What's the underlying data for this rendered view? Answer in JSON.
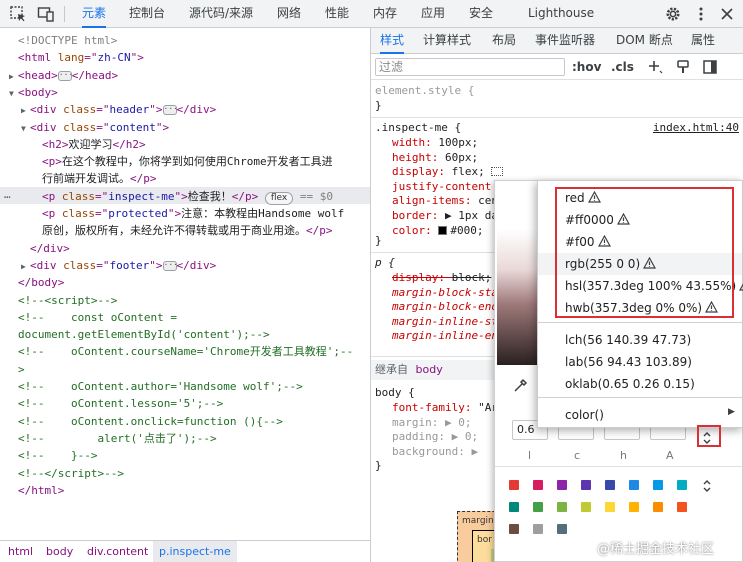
{
  "toolbar": {
    "tabs": [
      "元素",
      "控制台",
      "源代码/来源",
      "网络",
      "性能",
      "内存",
      "应用",
      "安全",
      "Lighthouse"
    ],
    "active_tab": "元素"
  },
  "elements": {
    "lines": [
      {
        "indent": 0,
        "html": "<span class='dt'>&lt;!DOCTYPE html&gt;</span>"
      },
      {
        "indent": 0,
        "html": "<span class='tag'>&lt;html </span><span class='an'>lang</span><span class='tag'>=\"</span><span class='av'>zh-CN</span><span class='tag'>\"&gt;</span>"
      },
      {
        "indent": 0,
        "tri": "▶",
        "html": "<span class='tag'>&lt;head&gt;</span><span class='dots'>···</span><span class='tag'>&lt;/head&gt;</span>"
      },
      {
        "indent": 0,
        "tri": "▼",
        "html": "<span class='tag'>&lt;body&gt;</span>"
      },
      {
        "indent": 1,
        "tri": "▶",
        "html": "<span class='tag'>&lt;div </span><span class='an'>class</span><span class='tag'>=\"</span><span class='av'>header</span><span class='tag'>\"&gt;</span><span class='dots'>···</span><span class='tag'>&lt;/div&gt;</span>"
      },
      {
        "indent": 1,
        "tri": "▼",
        "html": "<span class='tag'>&lt;div </span><span class='an'>class</span><span class='tag'>=\"</span><span class='av'>content</span><span class='tag'>\"&gt;</span>"
      },
      {
        "indent": 2,
        "html": "<span class='tag'>&lt;h2&gt;</span><span class='txt'>欢迎学习</span><span class='tag'>&lt;/h2&gt;</span>"
      },
      {
        "indent": 2,
        "html": "<span class='tag'>&lt;p&gt;</span><span class='txt'>在这个教程中，你将学到如何使用Chrome开发者工具进</span>"
      },
      {
        "indent": 2,
        "html": "<span class='txt'>行前端开发调试。</span><span class='tag'>&lt;/p&gt;</span>"
      },
      {
        "indent": 2,
        "sel": true,
        "html": "<span class='tag'>&lt;p </span><span class='an'>class</span><span class='tag'>=\"</span><span class='av'>inspect-me</span><span class='tag'>\"&gt;</span><span class='txt'>检查我！</span><span class='tag'>&lt;/p&gt;</span> <span class='badge'>flex</span> <span class='dt'>== $0</span>"
      },
      {
        "indent": 2,
        "html": "<span class='tag'>&lt;p </span><span class='an'>class</span><span class='tag'>=\"</span><span class='av'>protected</span><span class='tag'>\"&gt;</span><span class='txt'>注意：本教程由Handsome wolf</span>"
      },
      {
        "indent": 2,
        "html": "<span class='txt'>原创，版权所有，未经允许不得转载或用于商业用途。</span><span class='tag'>&lt;/p&gt;</span>"
      },
      {
        "indent": 1,
        "html": "<span class='tag'>&lt;/div&gt;</span>"
      },
      {
        "indent": 1,
        "tri": "▶",
        "html": "<span class='tag'>&lt;div </span><span class='an'>class</span><span class='tag'>=\"</span><span class='av'>footer</span><span class='tag'>\"&gt;</span><span class='dots'>···</span><span class='tag'>&lt;/div&gt;</span>"
      },
      {
        "indent": 0,
        "html": "<span class='tag'>&lt;/body&gt;</span>"
      },
      {
        "indent": 0,
        "html": "<span class='cm'>&lt;!--&lt;script&gt;--&gt;</span>"
      },
      {
        "indent": 0,
        "html": "<span class='cm'>&lt;!--    const oContent =</span>"
      },
      {
        "indent": 0,
        "html": "<span class='cm'>document.getElementById('content');--&gt;</span>"
      },
      {
        "indent": 0,
        "html": "<span class='cm'>&lt;!--    oContent.courseName='Chrome开发者工具教程';--</span>"
      },
      {
        "indent": 0,
        "html": "<span class='cm'>&gt;</span>"
      },
      {
        "indent": 0,
        "html": "<span class='cm'>&lt;!--    oContent.author='Handsome wolf';--&gt;</span>"
      },
      {
        "indent": 0,
        "html": "<span class='cm'>&lt;!--    oContent.lesson='5';--&gt;</span>"
      },
      {
        "indent": 0,
        "html": "<span class='cm'>&lt;!--    oContent.onclick=function (){--&gt;</span>"
      },
      {
        "indent": 0,
        "html": "<span class='cm'>&lt;!--        alert('点击了');--&gt;</span>"
      },
      {
        "indent": 0,
        "html": "<span class='cm'>&lt;!--    }--&gt;</span>"
      },
      {
        "indent": 0,
        "html": "<span class='cm'>&lt;!--&lt;/script&gt;--&gt;</span>"
      },
      {
        "indent": 0,
        "html": "<span class='tag'>&lt;/html&gt;</span>"
      }
    ]
  },
  "breadcrumbs": [
    "html",
    "body",
    "div.content",
    "p.inspect-me"
  ],
  "styles": {
    "subtabs": [
      "样式",
      "计算样式",
      "布局",
      "事件监听器",
      "DOM 断点",
      "属性"
    ],
    "filter_placeholder": "过滤",
    "hov": ":hov",
    "cls": ".cls",
    "element_style": "element.style {",
    "close_brace": "}",
    "rule_selector": ".inspect-me {",
    "rule_source": "index.html:40",
    "rule_lines": [
      {
        "p": "width",
        "v": "100px;"
      },
      {
        "p": "height",
        "v": "60px;"
      },
      {
        "p": "display",
        "v": "flex;"
      },
      {
        "p": "justify-content",
        "v": "cente"
      },
      {
        "p": "align-items",
        "v": "center;"
      },
      {
        "p": "border",
        "v": "▶ 1px dashed"
      },
      {
        "p": "color",
        "v": "#000;"
      }
    ],
    "p_selector": "p {",
    "p_lines": [
      {
        "p": "display",
        "v": "block;",
        "strike": true
      },
      {
        "p": "margin-block-sta",
        "v": "",
        "italic": true
      },
      {
        "p": "margin-block-end",
        "v": "",
        "italic": true
      },
      {
        "p": "margin-inline-st",
        "v": "",
        "italic": true
      },
      {
        "p": "margin-inline-en",
        "v": "",
        "italic": true
      }
    ],
    "inherited_label": "继承自",
    "inherited_from": "body",
    "body_selector": "body {",
    "body_lines": [
      {
        "p": "font-family",
        "v": "\"Ar",
        "dim": false
      },
      {
        "p": "margin",
        "v": "▶ 0;",
        "dim": true
      },
      {
        "p": "padding",
        "v": "▶ 0;",
        "dim": true
      },
      {
        "p": "background",
        "v": "▶",
        "dim": true
      }
    ]
  },
  "picker": {
    "inputs": [
      "0.6",
      "",
      "",
      ""
    ],
    "labels": [
      "l",
      "c",
      "h",
      "A"
    ],
    "palette": [
      "#e53935",
      "#d81b60",
      "#8e24aa",
      "#5e35b1",
      "#3949ab",
      "#1e88e5",
      "#039be5",
      "#00acc1",
      "#00897b",
      "#43a047",
      "#7cb342",
      "#c0ca33",
      "#fdd835",
      "#ffb300",
      "#fb8c00",
      "#f4511e",
      "#6d4c41",
      "#9e9e9e",
      "#546e7a"
    ],
    "accent_red": "#d93036"
  },
  "formats": {
    "group1": [
      {
        "label": "red",
        "warn": true
      },
      {
        "label": "#ff0000",
        "warn": true
      },
      {
        "label": "#f00",
        "warn": true
      },
      {
        "label": "rgb(255 0 0)",
        "warn": true,
        "highlight": true
      },
      {
        "label": "hsl(357.3deg 100% 43.55%)",
        "warn": true
      },
      {
        "label": "hwb(357.3deg 0% 0%)",
        "warn": true
      }
    ],
    "group2": [
      {
        "label": "lch(56 140.39 47.73)"
      },
      {
        "label": "lab(56 94.43 103.89)"
      },
      {
        "label": "oklab(0.65 0.26 0.15)"
      }
    ],
    "color_fn": "color()"
  },
  "watermark": "@稀土掘金技术社区"
}
